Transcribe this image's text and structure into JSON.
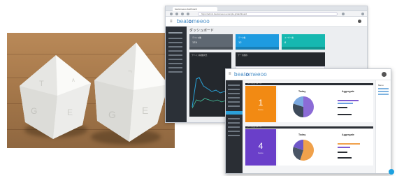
{
  "back_window": {
    "tab_title": "beatomeeoo dashboard",
    "url": "https://admin.beatomeeoo.example.jp/dashboard",
    "logo": {
      "prefix": "beat",
      "mark": "o",
      "suffix": "meeoo"
    },
    "page_title": "ダッシュボード",
    "cards": [
      {
        "label": "デバイス数",
        "value": "174",
        "color": "#5f6872"
      },
      {
        "label": "データ数",
        "value": "12",
        "color": "#1e9be0"
      },
      {
        "label": "ユーザー数",
        "value": "8",
        "color": "#16b8b0"
      }
    ],
    "panel_left_title": "デバイス稼働状況",
    "panel_right_title": "データ推移"
  },
  "front_window": {
    "logo": {
      "prefix": "beat",
      "mark": "o",
      "suffix": "meeoo"
    },
    "right_nav_title": "Menu",
    "sections": [
      {
        "strip": "デバイス名 タイトル",
        "big_number": "1",
        "caption": "Device",
        "color": "#f28a13",
        "today_label": "Today",
        "aggregate_label": "Aggregate",
        "pie": [
          {
            "value": 50,
            "color": "#8b6bd6"
          },
          {
            "value": 30,
            "color": "#3d4a5a"
          },
          {
            "value": 20,
            "color": "#7aa8e0"
          }
        ]
      },
      {
        "strip": "デバイス名 タイトル",
        "big_number": "4",
        "caption": "Device",
        "color": "#6a3fc9",
        "today_label": "Today",
        "aggregate_label": "Aggregate",
        "pie": [
          {
            "value": 55,
            "color": "#f0a14b"
          },
          {
            "value": 25,
            "color": "#4a5566"
          },
          {
            "value": 20,
            "color": "#6f57c9"
          }
        ]
      }
    ]
  },
  "colors": {
    "brand_blue": "#2d6db3",
    "sidebar_dark": "#2a2e34",
    "accent_cyan": "#1da1e0"
  }
}
